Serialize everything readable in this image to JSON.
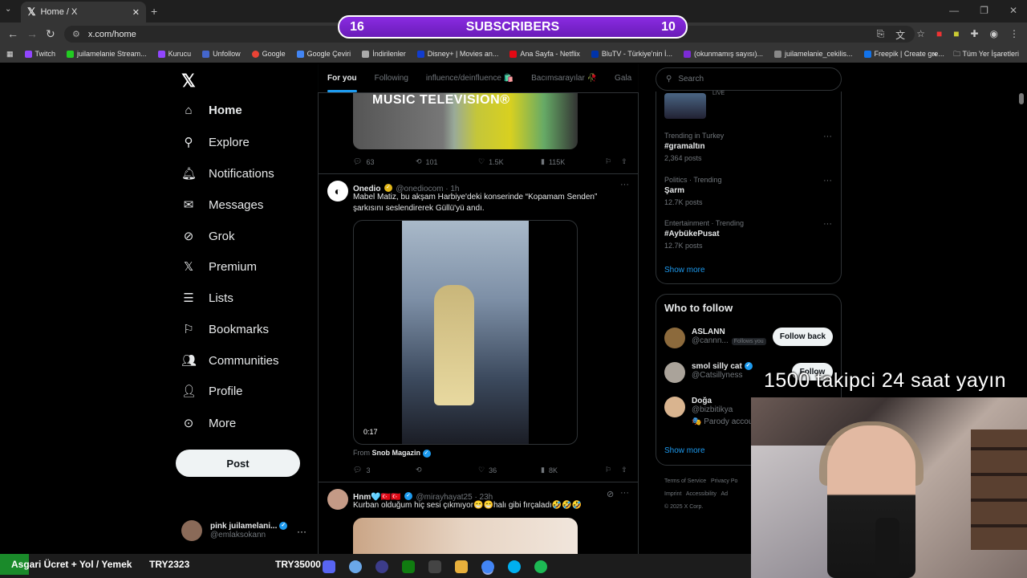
{
  "browser": {
    "tab_title": "Home / X",
    "url": "x.com/home",
    "bookmarks": [
      {
        "label": "Twitch",
        "color": "#9146ff"
      },
      {
        "label": "juilamelanie Stream...",
        "color": "#22cc22"
      },
      {
        "label": "Kurucu",
        "color": "#9146ff"
      },
      {
        "label": "Unfollow",
        "color": "#4466cc"
      },
      {
        "label": "Google",
        "color": "#ea4335"
      },
      {
        "label": "Google Çeviri",
        "color": "#4285f4"
      },
      {
        "label": "İndirilenler",
        "color": "#aaaaaa"
      },
      {
        "label": "Disney+ | Movies an...",
        "color": "#113ccf"
      },
      {
        "label": "Ana Sayfa - Netflix",
        "color": "#e50914"
      },
      {
        "label": "BluTV - Türkiye'nin İ...",
        "color": "#0033aa"
      },
      {
        "label": "(okunmamış sayısı)...",
        "color": "#7b2bd6"
      },
      {
        "label": "juilamelanie_cekilis...",
        "color": "#888888"
      },
      {
        "label": "Freepik | Create gre...",
        "color": "#1273eb"
      }
    ],
    "all_bookmarks_label": "Tüm Yer İşaretleri"
  },
  "overlay": {
    "left_count": "16",
    "title": "SUBSCRIBERS",
    "right_count": "10",
    "goal_text": "1500 takipci 24 saat yayın",
    "ticker_label": "Asgari Ücret + Yol / Yemek",
    "ticker_a": "TRY2323",
    "ticker_b": "TRY35000"
  },
  "nav": {
    "items": [
      {
        "label": "Home",
        "icon": "home-icon"
      },
      {
        "label": "Explore",
        "icon": "search-icon"
      },
      {
        "label": "Notifications",
        "icon": "bell-icon"
      },
      {
        "label": "Messages",
        "icon": "mail-icon"
      },
      {
        "label": "Grok",
        "icon": "grok-icon"
      },
      {
        "label": "Premium",
        "icon": "x-icon"
      },
      {
        "label": "Lists",
        "icon": "list-icon"
      },
      {
        "label": "Bookmarks",
        "icon": "bookmark-icon"
      },
      {
        "label": "Communities",
        "icon": "people-icon"
      },
      {
        "label": "Profile",
        "icon": "person-icon"
      },
      {
        "label": "More",
        "icon": "more-icon"
      }
    ],
    "post_label": "Post",
    "account_name": "pink juilamelani...",
    "account_handle": "@emlaksokann"
  },
  "timeline": {
    "tabs": [
      "For you",
      "Following",
      "influence/deinfluence 🛍️",
      "Bacımsarayılar 🥀",
      "Gala"
    ],
    "tweet1": {
      "image_text": "MUSIC TELEVISION®",
      "replies": "63",
      "reposts": "101",
      "likes": "1.5K",
      "views": "115K"
    },
    "tweet2": {
      "name": "Onedio",
      "handle": "@onediocom · 1h",
      "text": "Mabel Matiz, bu akşam Harbiye'deki konserinde “Kopamam Senden” şarkısını seslendirerek Güllü'yü andı.",
      "video_time": "0:17",
      "from_label": "From",
      "from_source": "Snob Magazin",
      "replies": "3",
      "reposts": "",
      "likes": "36",
      "views": "8K"
    },
    "tweet3": {
      "name": "Hnm🩵🇹🇷🇹🇷",
      "handle": "@mirayhayat25 · 23h",
      "text": "Kurban olduğum hiç sesi çıkmıyor😁😁halı gibi fırçaladı🤣🤣🤣"
    }
  },
  "sidebar": {
    "search_placeholder": "Search",
    "live_label": "LIVE",
    "trends": [
      {
        "context": "Trending in Turkey",
        "title": "#gramaltın",
        "posts": "2,364 posts"
      },
      {
        "context": "Politics · Trending",
        "title": "Şarm",
        "posts": "12.7K posts"
      },
      {
        "context": "Entertainment · Trending",
        "title": "#AybükePusat",
        "posts": "12.7K posts"
      }
    ],
    "show_more": "Show more",
    "who_to_follow_title": "Who to follow",
    "suggestions": [
      {
        "name": "ASLANN",
        "handle": "@cannn...",
        "badge": "Follows you",
        "button": "Follow back"
      },
      {
        "name": "smol silly cat",
        "handle": "@Catsillyness",
        "badge": "",
        "button": "Follow"
      },
      {
        "name": "Doğa",
        "handle": "@bizbitikya",
        "badge": "🎭 Parody accou",
        "button": ""
      }
    ],
    "footer_links": [
      "Terms of Service",
      "Privacy Po",
      "Imprint",
      "Accessibility",
      "Ad",
      "© 2025 X Corp."
    ]
  }
}
